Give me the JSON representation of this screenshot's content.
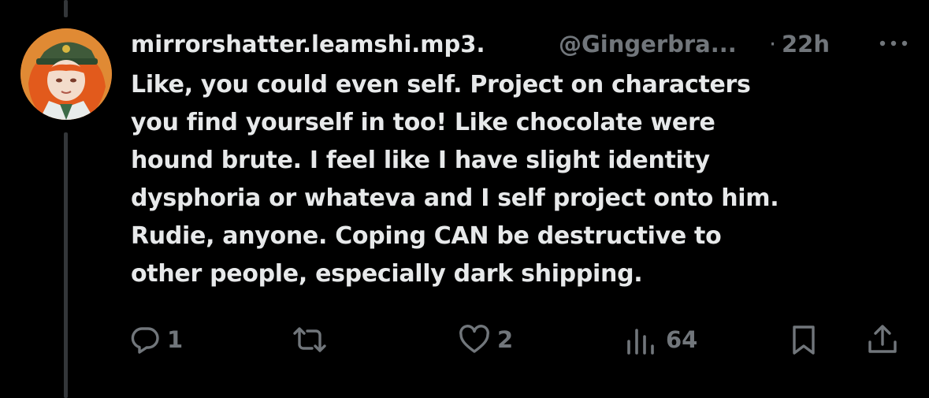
{
  "post": {
    "display_name": "mirrorshatter.leamshi.mp3.",
    "handle": "@Gingerbra...",
    "separator": "·",
    "time": "22h",
    "lines": [
      "Like, you could even self. Project on characters",
      "you find yourself in too! Like chocolate were",
      "hound brute. I feel like I have slight identity",
      "dysphoria or whateva and I self project onto him.",
      "Rudie, anyone. Coping CAN be destructive to",
      "other people, especially dark shipping."
    ]
  },
  "actions": {
    "reply_count": "1",
    "repost_count": "",
    "like_count": "2",
    "views_count": "64"
  },
  "icons": {
    "more": "more-horizontal-icon",
    "reply": "reply-icon",
    "repost": "repost-icon",
    "like": "heart-icon",
    "views": "views-icon",
    "bookmark": "bookmark-icon",
    "share": "share-icon"
  },
  "colors": {
    "background": "#000000",
    "primary_text": "#e7e9ea",
    "secondary_text": "#71767b",
    "thread_line": "#333639"
  }
}
